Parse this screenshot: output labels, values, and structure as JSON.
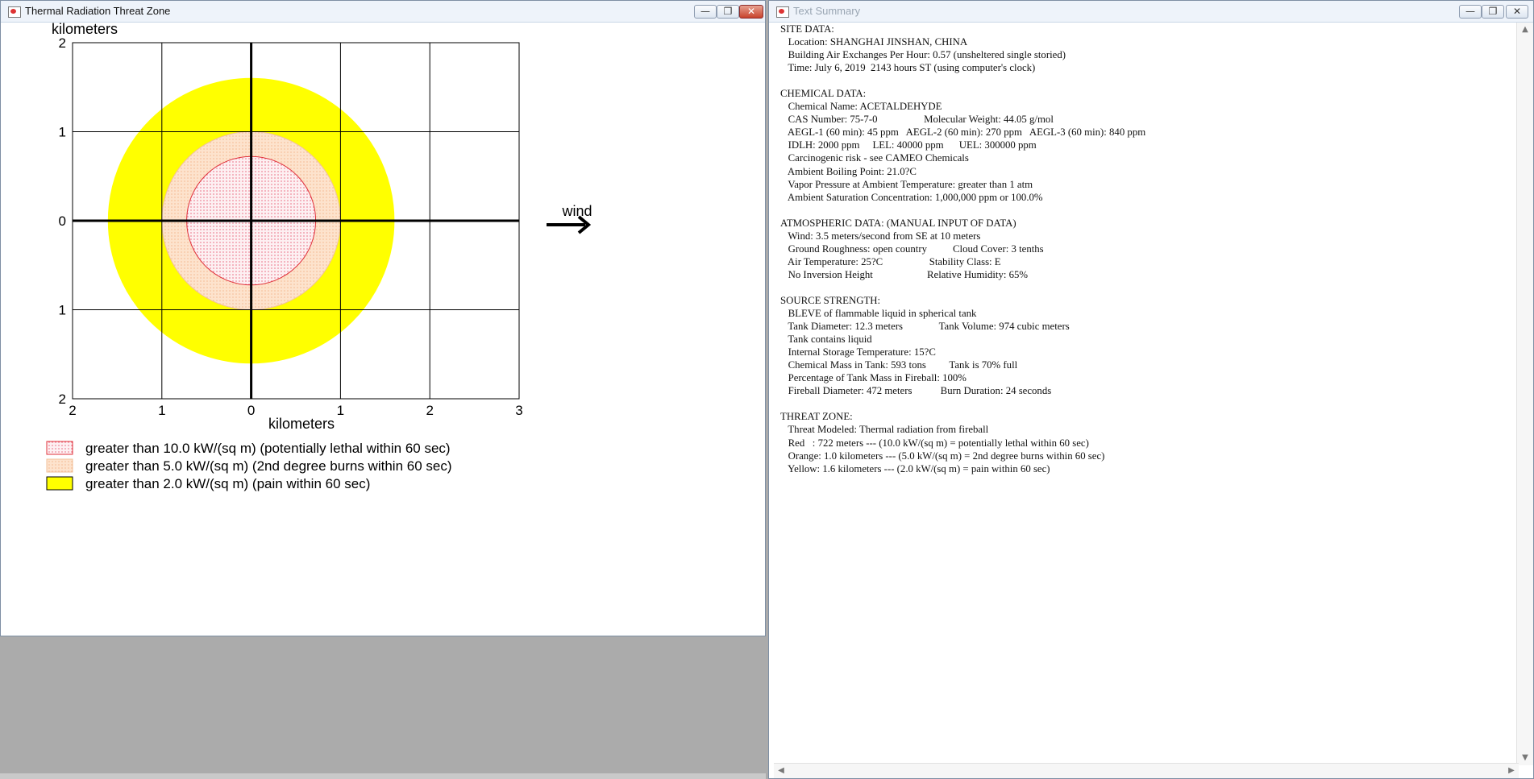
{
  "plot_window": {
    "title": "Thermal Radiation Threat Zone",
    "minimize": "—",
    "maximize": "❐",
    "close": "✕"
  },
  "summary_window": {
    "title": "Text Summary",
    "minimize": "—",
    "maximize": "❐",
    "close": "✕",
    "text": "SITE DATA:\n   Location: SHANGHAI JINSHAN, CHINA\n   Building Air Exchanges Per Hour: 0.57 (unsheltered single storied)\n   Time: July 6, 2019  2143 hours ST (using computer's clock)\n\nCHEMICAL DATA:\n   Chemical Name: ACETALDEHYDE\n   CAS Number: 75-7-0                  Molecular Weight: 44.05 g/mol\n   AEGL-1 (60 min): 45 ppm   AEGL-2 (60 min): 270 ppm   AEGL-3 (60 min): 840 ppm\n   IDLH: 2000 ppm     LEL: 40000 ppm      UEL: 300000 ppm\n   Carcinogenic risk - see CAMEO Chemicals\n   Ambient Boiling Point: 21.0?C\n   Vapor Pressure at Ambient Temperature: greater than 1 atm\n   Ambient Saturation Concentration: 1,000,000 ppm or 100.0%\n\nATMOSPHERIC DATA: (MANUAL INPUT OF DATA)\n   Wind: 3.5 meters/second from SE at 10 meters\n   Ground Roughness: open country          Cloud Cover: 3 tenths\n   Air Temperature: 25?C                  Stability Class: E\n   No Inversion Height                     Relative Humidity: 65%\n\nSOURCE STRENGTH:\n   BLEVE of flammable liquid in spherical tank\n   Tank Diameter: 12.3 meters              Tank Volume: 974 cubic meters\n   Tank contains liquid\n   Internal Storage Temperature: 15?C\n   Chemical Mass in Tank: 593 tons         Tank is 70% full\n   Percentage of Tank Mass in Fireball: 100%\n   Fireball Diameter: 472 meters           Burn Duration: 24 seconds\n\nTHREAT ZONE:\n   Threat Modeled: Thermal radiation from fireball\n   Red   : 722 meters --- (10.0 kW/(sq m) = potentially lethal within 60 sec)\n   Orange: 1.0 kilometers --- (5.0 kW/(sq m) = 2nd degree burns within 60 sec)\n   Yellow: 1.6 kilometers --- (2.0 kW/(sq m) = pain within 60 sec)"
  },
  "scrollbars": {
    "up": "▲",
    "down": "▼",
    "left": "◀",
    "right": "▶"
  },
  "chart_data": {
    "type": "threat-zone-circles",
    "x_axis_label": "kilometers",
    "y_axis_label": "kilometers",
    "xlim": [
      -2,
      3
    ],
    "ylim": [
      -2,
      2
    ],
    "x_tick_labels": [
      "2",
      "1",
      "0",
      "1",
      "2",
      "3"
    ],
    "x_tick_values": [
      -2,
      -1,
      0,
      1,
      2,
      3
    ],
    "y_tick_labels": [
      "2",
      "1",
      "0",
      "1",
      "2"
    ],
    "y_tick_values": [
      2,
      1,
      0,
      -1,
      -2
    ],
    "grid": true,
    "wind_label": "wind",
    "zones": [
      {
        "name": "yellow",
        "radius_km": 1.6,
        "color": "#ffff00",
        "pattern": "solid"
      },
      {
        "name": "orange",
        "radius_km": 1.0,
        "color": "#fbdcc0",
        "pattern": "dots"
      },
      {
        "name": "red",
        "radius_km": 0.722,
        "color": "#fde7ea",
        "pattern": "dots"
      }
    ],
    "legend": [
      {
        "swatch": "red",
        "label": "greater than 10.0 kW/(sq m) (potentially lethal within 60 sec)"
      },
      {
        "swatch": "orange",
        "label": "greater than 5.0 kW/(sq m) (2nd degree burns within 60 sec)"
      },
      {
        "swatch": "yellow",
        "label": "greater than 2.0 kW/(sq m) (pain within 60 sec)"
      }
    ]
  }
}
